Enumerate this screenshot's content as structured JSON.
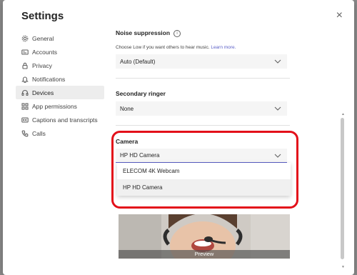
{
  "dialog": {
    "title": "Settings",
    "close_label": "×"
  },
  "nav": [
    {
      "label": "General",
      "icon": "gear-icon"
    },
    {
      "label": "Accounts",
      "icon": "id-card-icon"
    },
    {
      "label": "Privacy",
      "icon": "lock-icon"
    },
    {
      "label": "Notifications",
      "icon": "bell-icon"
    },
    {
      "label": "Devices",
      "icon": "headset-icon",
      "active": true
    },
    {
      "label": "App permissions",
      "icon": "grid-icon"
    },
    {
      "label": "Captions and transcripts",
      "icon": "cc-icon"
    },
    {
      "label": "Calls",
      "icon": "phone-icon"
    }
  ],
  "noise": {
    "title": "Noise suppression",
    "info": "i",
    "hint": "Choose Low if you want others to hear music.",
    "learn_more": "Learn more.",
    "value": "Auto (Default)"
  },
  "ringer": {
    "title": "Secondary ringer",
    "value": "None"
  },
  "camera": {
    "title": "Camera",
    "value": "HP HD Camera",
    "options": [
      "ELECOM 4K Webcam",
      "HP HD Camera"
    ],
    "selected": "HP HD Camera"
  },
  "preview": {
    "label": "Preview"
  },
  "colors": {
    "accent": "#5b5fc7",
    "highlight": "#e3101a"
  }
}
